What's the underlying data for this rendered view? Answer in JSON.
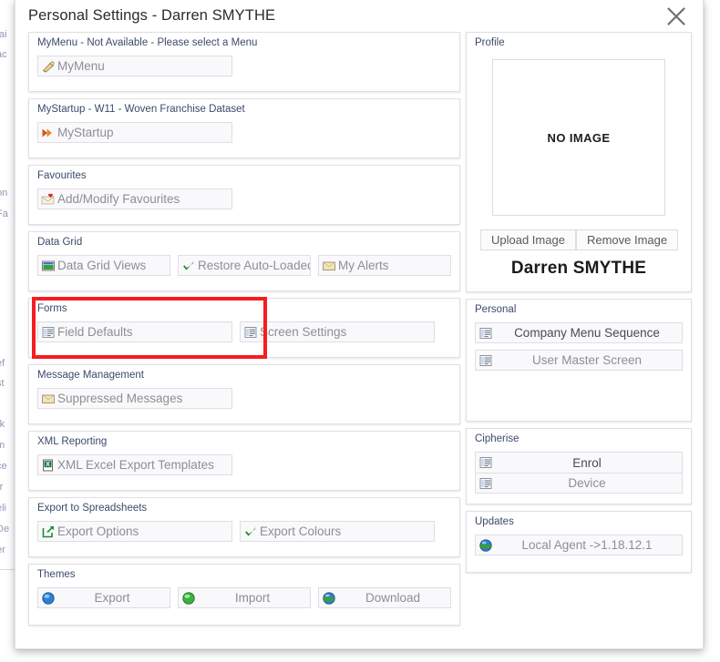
{
  "behind_page": {
    "clipped_lines": [
      "tai",
      "ac",
      "on",
      "Fa",
      "ef",
      "st",
      "rk",
      "m",
      "ce",
      "rr",
      "eli",
      "De",
      "er"
    ]
  },
  "dialog": {
    "title": "Personal Settings - Darren SMYTHE",
    "close_label": "Close"
  },
  "left_column": {
    "groups": [
      {
        "legend": "MyMenu - Not Available - Please select a Menu",
        "buttons": [
          {
            "label": "MyMenu",
            "icon": "mymenu-icon",
            "enabled": false
          }
        ]
      },
      {
        "legend": "MyStartup - W11 - Woven Franchise Dataset",
        "buttons": [
          {
            "label": "MyStartup",
            "icon": "mystartup-icon",
            "enabled": false
          }
        ]
      },
      {
        "legend": "Favourites",
        "buttons": [
          {
            "label": "Add/Modify Favourites",
            "icon": "favourites-heart-icon",
            "enabled": false
          }
        ]
      },
      {
        "legend": "Data Grid",
        "buttons": [
          {
            "label": "Data Grid Views",
            "icon": "data-grid-icon",
            "enabled": false
          },
          {
            "label": "Restore Auto-Loaded",
            "icon": "green-check-icon",
            "enabled": false
          },
          {
            "label": "My Alerts",
            "icon": "envelope-icon",
            "enabled": false
          }
        ]
      },
      {
        "legend": "Forms",
        "highlighted": true,
        "buttons": [
          {
            "label": "Field Defaults",
            "icon": "form-list-icon",
            "enabled": false
          },
          {
            "label": "Screen Settings",
            "icon": "form-list-icon",
            "enabled": false
          }
        ]
      },
      {
        "legend": "Message Management",
        "buttons": [
          {
            "label": "Suppressed Messages",
            "icon": "envelope-icon",
            "enabled": false
          }
        ]
      },
      {
        "legend": "XML Reporting",
        "buttons": [
          {
            "label": "XML Excel Export Templates",
            "icon": "excel-icon",
            "enabled": false
          }
        ]
      },
      {
        "legend": "Export to Spreadsheets",
        "buttons": [
          {
            "label": "Export Options",
            "icon": "export-arrow-icon",
            "enabled": false
          },
          {
            "label": "Export Colours",
            "icon": "green-check-icon",
            "enabled": false
          }
        ]
      },
      {
        "legend": "Themes",
        "buttons": [
          {
            "label": "Export",
            "icon": "blue-sphere-icon",
            "enabled": false
          },
          {
            "label": "Import",
            "icon": "green-sphere-icon",
            "enabled": false
          },
          {
            "label": "Download",
            "icon": "globe-icon",
            "enabled": false
          }
        ]
      }
    ]
  },
  "right_column": {
    "profile": {
      "legend": "Profile",
      "image_placeholder": "NO IMAGE",
      "upload_label": "Upload Image",
      "remove_label": "Remove Image",
      "user_name": "Darren SMYTHE"
    },
    "personal": {
      "legend": "Personal",
      "buttons": [
        {
          "label": "Company Menu Sequence",
          "icon": "form-list-icon",
          "enabled": true
        },
        {
          "label": "User Master Screen",
          "icon": "form-list-icon",
          "enabled": false
        }
      ]
    },
    "cipherise": {
      "legend": "Cipherise",
      "buttons": [
        {
          "label": "Enrol",
          "icon": "form-list-icon",
          "enabled": true
        },
        {
          "label": "Device",
          "icon": "form-list-icon",
          "enabled": false
        }
      ]
    },
    "updates": {
      "legend": "Updates",
      "buttons": [
        {
          "label": "Local Agent ->1.18.12.1",
          "icon": "globe-icon",
          "enabled": false
        }
      ]
    }
  },
  "colors": {
    "highlight": "#f51d20",
    "legend_text": "#3b4a6b",
    "disabled_text": "#8e8e94",
    "enabled_text": "#4a4a50",
    "button_bg": "#f9f9fb",
    "button_border": "#dedee4"
  }
}
